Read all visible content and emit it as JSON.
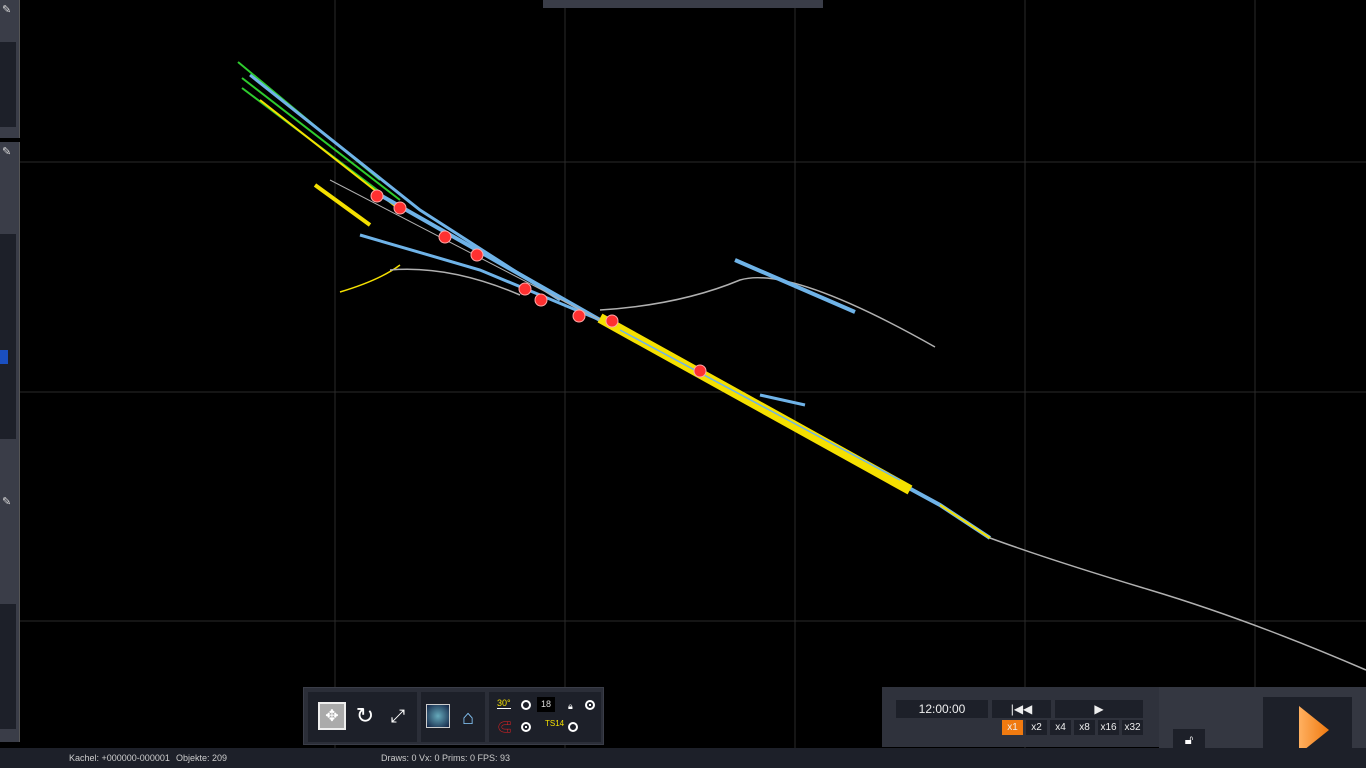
{
  "statusbar": {
    "tile": "Kachel: +000000-000001",
    "objects": "Objekte: 209",
    "stats": "Draws: 0 Vx: 0 Prims: 0 FPS: 93"
  },
  "toolbar": {
    "icons": [
      "fit-view-icon",
      "reset-rotation-icon",
      "fullscreen-icon",
      "globe-icon",
      "home-icon",
      "angle-30-icon",
      "magnet-icon",
      "ts14-icon",
      "lock-icon"
    ],
    "angle_label": "30°",
    "grid_value": "18",
    "ts_label": "TS14"
  },
  "time": {
    "clock": "12:00:00",
    "rewind_icon": "rewind-icon",
    "play_icon": "play-icon",
    "speeds": [
      "x1",
      "x2",
      "x4",
      "x8",
      "x16",
      "x32"
    ],
    "active_speed": "x1"
  },
  "lock": "unlock-icon",
  "start_button": "play-large-icon",
  "colors": {
    "accent": "#f07a10",
    "track_blue": "#6fb3e8",
    "track_yellow": "#f5e000",
    "track_green": "#2ecc2e",
    "signal_red": "#ff2a2a",
    "track_grey": "#b0b0b0",
    "background": "#000000"
  }
}
